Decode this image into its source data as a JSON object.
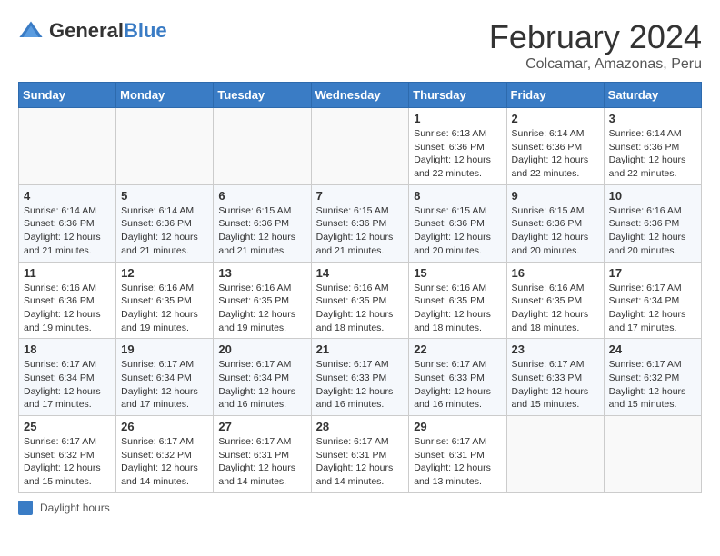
{
  "header": {
    "logo_general": "General",
    "logo_blue": "Blue",
    "month_title": "February 2024",
    "location": "Colcamar, Amazonas, Peru"
  },
  "weekdays": [
    "Sunday",
    "Monday",
    "Tuesday",
    "Wednesday",
    "Thursday",
    "Friday",
    "Saturday"
  ],
  "weeks": [
    [
      {
        "day": "",
        "info": ""
      },
      {
        "day": "",
        "info": ""
      },
      {
        "day": "",
        "info": ""
      },
      {
        "day": "",
        "info": ""
      },
      {
        "day": "1",
        "info": "Sunrise: 6:13 AM\nSunset: 6:36 PM\nDaylight: 12 hours and 22 minutes."
      },
      {
        "day": "2",
        "info": "Sunrise: 6:14 AM\nSunset: 6:36 PM\nDaylight: 12 hours and 22 minutes."
      },
      {
        "day": "3",
        "info": "Sunrise: 6:14 AM\nSunset: 6:36 PM\nDaylight: 12 hours and 22 minutes."
      }
    ],
    [
      {
        "day": "4",
        "info": "Sunrise: 6:14 AM\nSunset: 6:36 PM\nDaylight: 12 hours and 21 minutes."
      },
      {
        "day": "5",
        "info": "Sunrise: 6:14 AM\nSunset: 6:36 PM\nDaylight: 12 hours and 21 minutes."
      },
      {
        "day": "6",
        "info": "Sunrise: 6:15 AM\nSunset: 6:36 PM\nDaylight: 12 hours and 21 minutes."
      },
      {
        "day": "7",
        "info": "Sunrise: 6:15 AM\nSunset: 6:36 PM\nDaylight: 12 hours and 21 minutes."
      },
      {
        "day": "8",
        "info": "Sunrise: 6:15 AM\nSunset: 6:36 PM\nDaylight: 12 hours and 20 minutes."
      },
      {
        "day": "9",
        "info": "Sunrise: 6:15 AM\nSunset: 6:36 PM\nDaylight: 12 hours and 20 minutes."
      },
      {
        "day": "10",
        "info": "Sunrise: 6:16 AM\nSunset: 6:36 PM\nDaylight: 12 hours and 20 minutes."
      }
    ],
    [
      {
        "day": "11",
        "info": "Sunrise: 6:16 AM\nSunset: 6:36 PM\nDaylight: 12 hours and 19 minutes."
      },
      {
        "day": "12",
        "info": "Sunrise: 6:16 AM\nSunset: 6:35 PM\nDaylight: 12 hours and 19 minutes."
      },
      {
        "day": "13",
        "info": "Sunrise: 6:16 AM\nSunset: 6:35 PM\nDaylight: 12 hours and 19 minutes."
      },
      {
        "day": "14",
        "info": "Sunrise: 6:16 AM\nSunset: 6:35 PM\nDaylight: 12 hours and 18 minutes."
      },
      {
        "day": "15",
        "info": "Sunrise: 6:16 AM\nSunset: 6:35 PM\nDaylight: 12 hours and 18 minutes."
      },
      {
        "day": "16",
        "info": "Sunrise: 6:16 AM\nSunset: 6:35 PM\nDaylight: 12 hours and 18 minutes."
      },
      {
        "day": "17",
        "info": "Sunrise: 6:17 AM\nSunset: 6:34 PM\nDaylight: 12 hours and 17 minutes."
      }
    ],
    [
      {
        "day": "18",
        "info": "Sunrise: 6:17 AM\nSunset: 6:34 PM\nDaylight: 12 hours and 17 minutes."
      },
      {
        "day": "19",
        "info": "Sunrise: 6:17 AM\nSunset: 6:34 PM\nDaylight: 12 hours and 17 minutes."
      },
      {
        "day": "20",
        "info": "Sunrise: 6:17 AM\nSunset: 6:34 PM\nDaylight: 12 hours and 16 minutes."
      },
      {
        "day": "21",
        "info": "Sunrise: 6:17 AM\nSunset: 6:33 PM\nDaylight: 12 hours and 16 minutes."
      },
      {
        "day": "22",
        "info": "Sunrise: 6:17 AM\nSunset: 6:33 PM\nDaylight: 12 hours and 16 minutes."
      },
      {
        "day": "23",
        "info": "Sunrise: 6:17 AM\nSunset: 6:33 PM\nDaylight: 12 hours and 15 minutes."
      },
      {
        "day": "24",
        "info": "Sunrise: 6:17 AM\nSunset: 6:32 PM\nDaylight: 12 hours and 15 minutes."
      }
    ],
    [
      {
        "day": "25",
        "info": "Sunrise: 6:17 AM\nSunset: 6:32 PM\nDaylight: 12 hours and 15 minutes."
      },
      {
        "day": "26",
        "info": "Sunrise: 6:17 AM\nSunset: 6:32 PM\nDaylight: 12 hours and 14 minutes."
      },
      {
        "day": "27",
        "info": "Sunrise: 6:17 AM\nSunset: 6:31 PM\nDaylight: 12 hours and 14 minutes."
      },
      {
        "day": "28",
        "info": "Sunrise: 6:17 AM\nSunset: 6:31 PM\nDaylight: 12 hours and 14 minutes."
      },
      {
        "day": "29",
        "info": "Sunrise: 6:17 AM\nSunset: 6:31 PM\nDaylight: 12 hours and 13 minutes."
      },
      {
        "day": "",
        "info": ""
      },
      {
        "day": "",
        "info": ""
      }
    ]
  ],
  "legend": {
    "label": "Daylight hours"
  }
}
